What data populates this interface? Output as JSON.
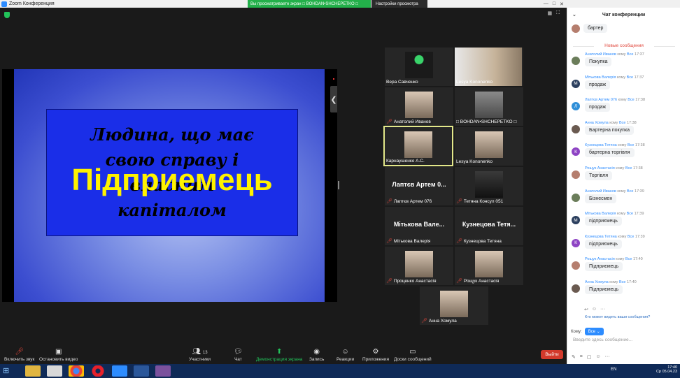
{
  "window": {
    "title": "Zoom Конференция",
    "share_banner": "Вы  просматриваете  экран □ BOHDAN•SHCHEPETKO □",
    "view_options": "Настройки просмотра"
  },
  "slide": {
    "background_text": [
      "Людина, що має",
      "свою справу і",
      "власним",
      "капіталом"
    ],
    "title": "Підприемець"
  },
  "tiles": [
    {
      "name": "Вера Савченко",
      "muted": false
    },
    {
      "name": "Lesya Kononenko",
      "muted": false
    },
    {
      "name": "Анатолий Иванов",
      "muted": true
    },
    {
      "name": "□ BOHDAN•SHCHEPETKO □",
      "muted": false
    },
    {
      "name": "Карнаушенко А.С.",
      "muted": false
    },
    {
      "name": "Lesya Kononenko",
      "muted": false
    },
    {
      "name": "Лаптєв Артем 076",
      "center": "Лаптєв Артем 0...",
      "muted": true
    },
    {
      "name": "Тетяна Консул 051",
      "muted": true
    },
    {
      "name": "Мітькова Валерія",
      "center": "Мітькова Вале...",
      "muted": true
    },
    {
      "name": "Кузнецова Тетяна",
      "center": "Кузнецова Тетя...",
      "muted": true
    },
    {
      "name": "Проценко Анастасія",
      "muted": true
    },
    {
      "name": "Рощук Анастасія",
      "muted": true
    },
    {
      "name": "Анна Хомула",
      "muted": true
    }
  ],
  "toolbar": {
    "audio": "Включить звук",
    "video": "Остановить видео",
    "participants": "Участники",
    "participants_count": "13",
    "chat": "Чат",
    "share": "Демонстрация экрана",
    "record": "Запись",
    "reactions": "Реакции",
    "apps": "Приложения",
    "whiteboards": "Доски сообщений",
    "leave": "Выйти"
  },
  "chat": {
    "title": "Чат конференции",
    "previous_message": "бартер",
    "new_messages_label": "Новые сообщения",
    "to_word": "кому",
    "all_word": "Все",
    "messages": [
      {
        "sender": "Анатолий Иванов",
        "time": "17:37",
        "text": "Покупка",
        "initial": "",
        "color": "#6b7d5a"
      },
      {
        "sender": "Мітькова Валерія",
        "time": "17:37",
        "text": "продаж",
        "initial": "М",
        "color": "#2b3f5e"
      },
      {
        "sender": "Лаптєв Артем 076",
        "time": "17:38",
        "text": "продаж",
        "initial": "Л",
        "color": "#2f8fd8"
      },
      {
        "sender": "Анна Хомула",
        "time": "17:38",
        "text": "Бартерна покупка",
        "initial": "",
        "color": "#6a5a50"
      },
      {
        "sender": "Кузнецова Тетяна",
        "time": "17:38",
        "text": "бартерна торгівля",
        "initial": "К",
        "color": "#8e44c4"
      },
      {
        "sender": "Рощук Анастасія",
        "time": "17:38",
        "text": "Торгівля",
        "initial": "",
        "color": "#b57e6e"
      },
      {
        "sender": "Анатолий Иванов",
        "time": "17:39",
        "text": "Бізнесмен",
        "initial": "",
        "color": "#6b7d5a"
      },
      {
        "sender": "Мітькова Валерія",
        "time": "17:39",
        "text": "підприємець",
        "initial": "М",
        "color": "#2b3f5e"
      },
      {
        "sender": "Кузнецова Тетяна",
        "time": "17:39",
        "text": "підприємець",
        "initial": "К",
        "color": "#8e44c4"
      },
      {
        "sender": "Рощук Анастасія",
        "time": "17:40",
        "text": "Підприємець",
        "initial": "",
        "color": "#b57e6e"
      },
      {
        "sender": "Анна Хомула",
        "time": "17:40",
        "text": "Підприємець",
        "initial": "",
        "color": "#6a5a50"
      }
    ],
    "who_can_see": "Кто может видеть ваши сообщения?",
    "to_label": "Кому:",
    "to_value": "Все",
    "input_placeholder": "Введите здесь сообщение..."
  },
  "taskbar": {
    "lang": "EN",
    "time": "17:40",
    "date": "Ср 05.04.23"
  }
}
